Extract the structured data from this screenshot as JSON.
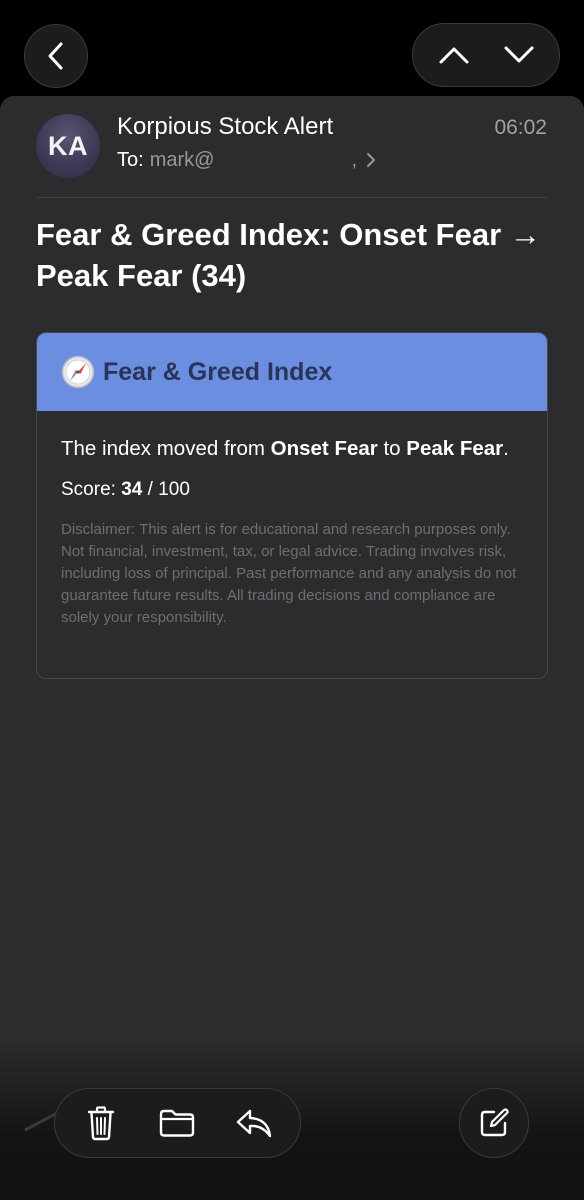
{
  "header": {
    "sender_initials": "KA",
    "sender_name": "Korpious Stock Alert",
    "time": "06:02",
    "to_label": "To:",
    "to_value": "mark@",
    "to_comma": ","
  },
  "subject": "Fear & Greed Index: Onset Fear → Peak Fear (34)",
  "card": {
    "title": "Fear & Greed Index",
    "title_icon": "compass-icon",
    "moved_prefix": "The index moved from ",
    "from_state": "Onset Fear",
    "moved_mid": " to ",
    "to_state": "Peak Fear",
    "moved_suffix": ".",
    "score_label": "Score: ",
    "score_value": "34",
    "score_max": " / 100",
    "disclaimer": "Disclaimer: This alert is for educational and research purposes only. Not financial, investment, tax, or legal advice. Trading involves risk, including loss of principal. Past performance and any analysis do not guarantee future results. All trading decisions and compliance are solely your responsibility."
  },
  "colors": {
    "card_header_bg": "#6b8ee0",
    "sheet_bg": "#2c2c2e",
    "accent_text": "#2a3358"
  },
  "icons": {
    "back": "chevron-left-icon",
    "prev": "chevron-up-icon",
    "next": "chevron-down-icon",
    "trash": "trash-icon",
    "folder": "folder-icon",
    "reply": "reply-icon",
    "compose": "compose-icon"
  }
}
